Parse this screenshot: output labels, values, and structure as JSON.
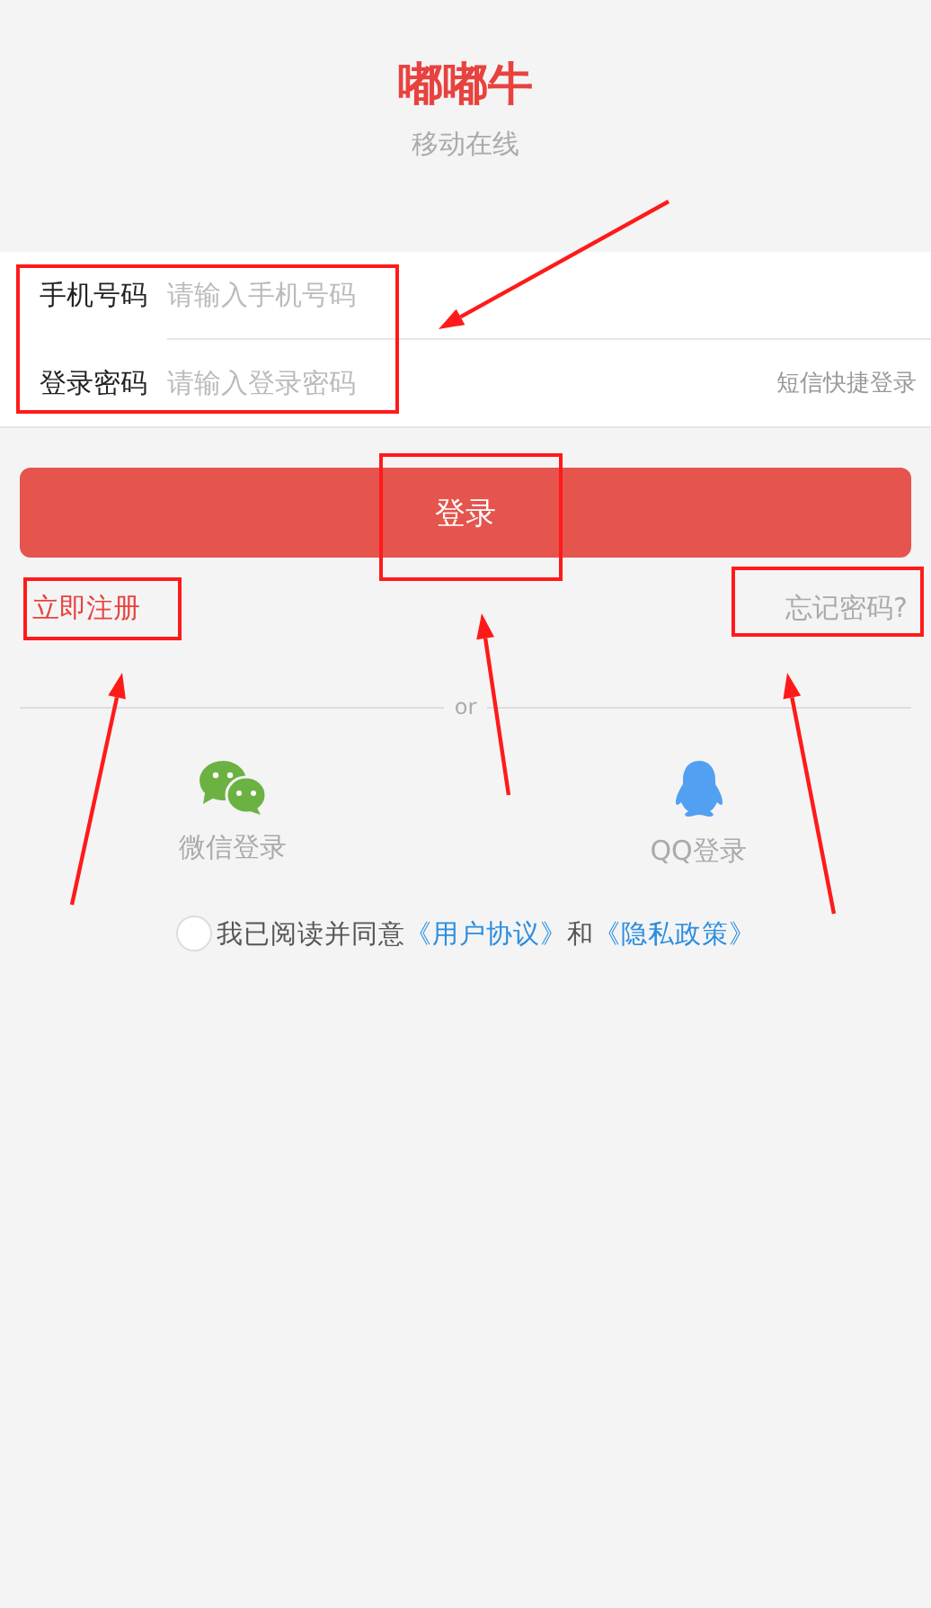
{
  "header": {
    "title": "嘟嘟牛",
    "subtitle": "移动在线"
  },
  "form": {
    "highlighted": true,
    "fields": [
      {
        "label": "手机号码",
        "placeholder": "请输入手机号码"
      },
      {
        "label": "登录密码",
        "placeholder": "请输入登录密码"
      }
    ],
    "sms_login": "短信快捷登录"
  },
  "login_button": {
    "label": "登录",
    "highlighted": true
  },
  "register_link": {
    "label": "立即注册",
    "highlighted": true
  },
  "forgot_link": {
    "label": "忘记密码?",
    "highlighted": true
  },
  "divider": "or",
  "social_logins": [
    {
      "kind": "wechat",
      "label": "微信登录"
    },
    {
      "kind": "qq",
      "label": "QQ登录"
    }
  ],
  "agreement": {
    "checked": false,
    "parts": [
      {
        "kind": "text",
        "text": "我已阅读并同意"
      },
      {
        "kind": "link",
        "text": "《用户协议》"
      },
      {
        "kind": "text",
        "text": "和"
      },
      {
        "kind": "link",
        "text": "《隐私政策》"
      }
    ]
  }
}
